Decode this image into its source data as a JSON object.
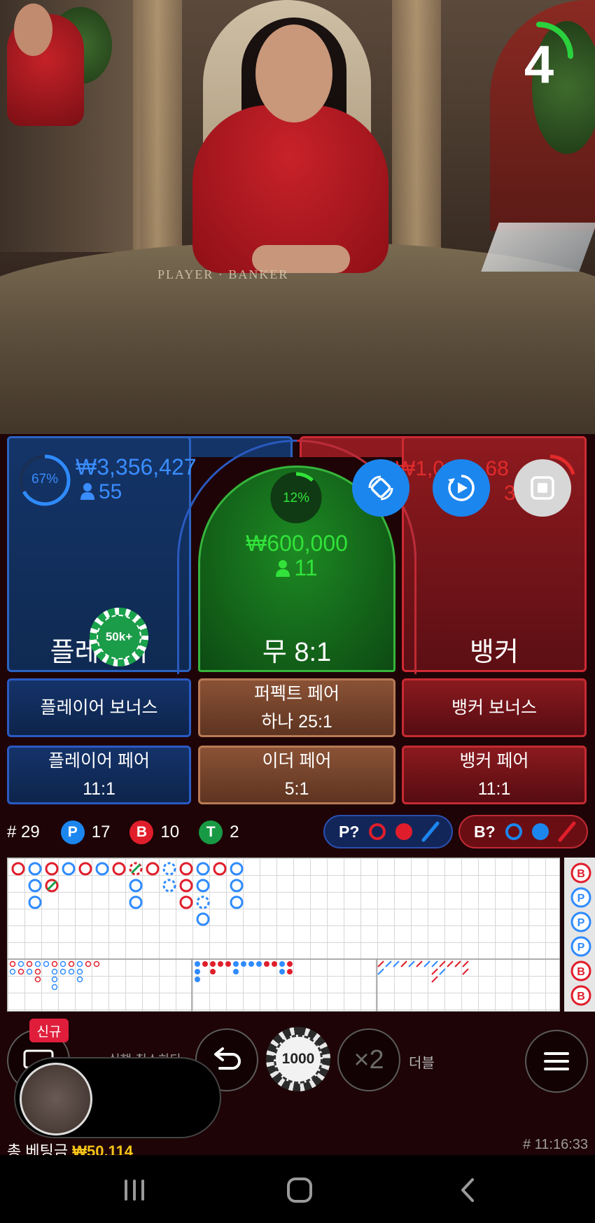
{
  "timer": {
    "seconds": "4",
    "remaining_fraction": 0.25
  },
  "video": {
    "table_text": "PLAYER · BANKER"
  },
  "player": {
    "percent": "67%",
    "percent_value": 0.67,
    "amount": "₩3,356,427",
    "count": "55",
    "label": "플레이어",
    "chip": "50k+"
  },
  "tie": {
    "percent": "12%",
    "percent_value": 0.12,
    "amount": "₩600,000",
    "count": "11",
    "label": "무 8:1"
  },
  "banker": {
    "amount": "₩1,0__,_68",
    "count": "33",
    "label": "뱅커",
    "percent_value": 0.21
  },
  "overlay_buttons": {
    "rotate": "rotate-icon",
    "replay": "replay-icon",
    "stop": "stop-icon"
  },
  "side_bets": {
    "player_bonus": "플레이어 보너스",
    "perfect_pair_line1": "퍼펙트 페어",
    "perfect_pair_line2": "하나 25:1",
    "banker_bonus": "뱅커 보너스",
    "player_pair_line1": "플레이어 페어",
    "player_pair_line2": "11:1",
    "either_pair_line1": "이더 페어",
    "either_pair_line2": "5:1",
    "banker_pair_line1": "뱅커 페어",
    "banker_pair_line2": "11:1"
  },
  "stats": {
    "rounds_label": "# 29",
    "p_letter": "P",
    "p_count": "17",
    "b_letter": "B",
    "b_count": "10",
    "t_letter": "T",
    "t_count": "2",
    "p_predict": "P?",
    "b_predict": "B?"
  },
  "road_side": [
    "B",
    "P",
    "P",
    "P",
    "B",
    "B"
  ],
  "controls": {
    "new_badge": "신규",
    "undo_label": "실행 취소하다",
    "chip_value": "1000",
    "double_symbol": "×2",
    "double_label": "더블"
  },
  "footer": {
    "total_bet_label": "총 베팅금",
    "total_bet_value": "₩50,114",
    "round_id": "# 11:16:33"
  },
  "colors": {
    "player": "#1c86ef",
    "banker": "#e22b2b",
    "tie": "#32e23a",
    "gold": "#f5c518"
  }
}
